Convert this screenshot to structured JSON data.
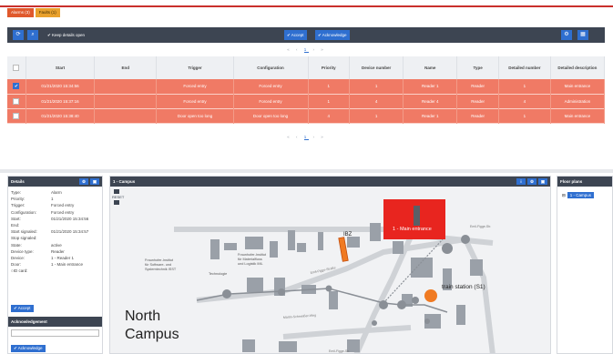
{
  "tabs": [
    {
      "label": "Alarms (3)"
    },
    {
      "label": "Faults (1)"
    }
  ],
  "toolbar": {
    "keep_details_label": "Keep details open",
    "accept_label": "Accept",
    "acknowledge_label": "Acknowledge"
  },
  "pager": {
    "prev": "«  ‹",
    "current": "1",
    "next": "›  »"
  },
  "table": {
    "columns": [
      "Start",
      "End",
      "Trigger",
      "Configuration",
      "Priority",
      "Device number",
      "Name",
      "Type",
      "Detailed number",
      "Detailed description"
    ],
    "rows": [
      {
        "checked": true,
        "cells": [
          "01/21/2020 15:34:56",
          "",
          "Forced entry",
          "Forced entry",
          "1",
          "1",
          "Reader 1",
          "Reader",
          "1",
          "Main entrance"
        ]
      },
      {
        "checked": false,
        "cells": [
          "01/21/2020 15:37:16",
          "",
          "Forced entry",
          "Forced entry",
          "1",
          "4",
          "Reader 4",
          "Reader",
          "4",
          "Administration"
        ]
      },
      {
        "checked": false,
        "cells": [
          "01/21/2020 15:38:40",
          "",
          "Door open too long",
          "Door open too long",
          "4",
          "1",
          "Reader 1",
          "Reader",
          "1",
          "Main entrance"
        ]
      }
    ]
  },
  "details": {
    "title": "Details",
    "fields": [
      {
        "k": "Type:",
        "v": "Alarm"
      },
      {
        "k": "Priority:",
        "v": "1"
      },
      {
        "k": "Trigger:",
        "v": "Forced entry"
      },
      {
        "k": "Configuration:",
        "v": "Forced entry"
      },
      {
        "k": "Start:",
        "v": "01/21/2020 15:34:56"
      },
      {
        "k": "End:",
        "v": ""
      },
      {
        "k": "Start signaled:",
        "v": "01/21/2020 15:34:57"
      },
      {
        "k": "Stop signaled:",
        "v": ""
      },
      {
        "k": "State:",
        "v": "active"
      },
      {
        "k": "Device type:",
        "v": "Reader"
      },
      {
        "k": "Device:",
        "v": "1 - Reader 1"
      },
      {
        "k": "Door:",
        "v": "1 - Main entrance"
      }
    ],
    "id_label": "ID card:",
    "accept_label": "Accept",
    "ack_title": "Acknowledgement",
    "acknowledge_label": "Acknowledge"
  },
  "map": {
    "title": "1 - Campus",
    "reset_label": "RESET",
    "labels": {
      "north": "North",
      "campus": "Campus",
      "ibz": "IBZ",
      "main_entrance": "1 - Main entrance",
      "train_station": "train station (S1)",
      "fraunhofer_1": "Fraunhofer-Institut",
      "fraunhofer_2": "für Software- und",
      "fraunhofer_3": "Systemtechnik ISST",
      "fraunhofer_b1": "Fraunhofer-Institut",
      "fraunhofer_b2": "für Materialfluss",
      "fraunhofer_b3": "und Logistik IML",
      "tech": "Technologie",
      "street1": "Emil-Figge-Straße",
      "street2": "Emil-Figge-Str.",
      "street3": "Martin-Schmeißer-Weg",
      "street4": "Emil-Figge-Str."
    },
    "colors": {
      "alarm": "#e8251f",
      "device": "#f07a22",
      "ibz": "#f07a22",
      "node": "#8a8f96"
    }
  },
  "floor": {
    "title": "Floor plans",
    "item": "1 - Campus"
  }
}
